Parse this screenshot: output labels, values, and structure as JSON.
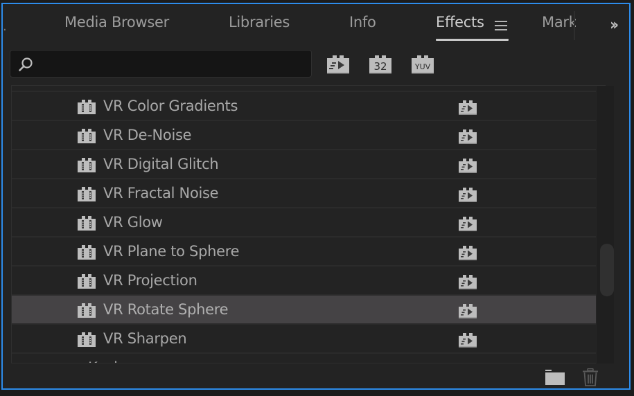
{
  "tabs": [
    {
      "label": "Media Browser",
      "active": false
    },
    {
      "label": "Libraries",
      "active": false
    },
    {
      "label": "Info",
      "active": false
    },
    {
      "label": "Effects",
      "active": true
    },
    {
      "label": "Markers",
      "visible_text": "Mark",
      "active": false
    }
  ],
  "tab_menu_icon": "hamburger-menu-icon",
  "overflow_icon": "double-chevron-right-icon",
  "search": {
    "value": "",
    "placeholder": "",
    "icon": "search-icon"
  },
  "filters": [
    {
      "name": "accelerated-effects-filter",
      "icon": "accelerated-effect-icon",
      "label": ""
    },
    {
      "name": "32-bit-filter",
      "icon": "32-bit-icon",
      "label": "32"
    },
    {
      "name": "yuv-filter",
      "icon": "yuv-icon",
      "label": "YUV"
    }
  ],
  "effects": [
    {
      "label": "VR Color Gradients",
      "accelerated": true,
      "selected": false
    },
    {
      "label": "VR De-Noise",
      "accelerated": true,
      "selected": false
    },
    {
      "label": "VR Digital Glitch",
      "accelerated": true,
      "selected": false
    },
    {
      "label": "VR Fractal Noise",
      "accelerated": true,
      "selected": false
    },
    {
      "label": "VR Glow",
      "accelerated": true,
      "selected": false
    },
    {
      "label": "VR Plane to Sphere",
      "accelerated": true,
      "selected": false
    },
    {
      "label": "VR Projection",
      "accelerated": true,
      "selected": false
    },
    {
      "label": "VR Rotate Sphere",
      "accelerated": true,
      "selected": true
    },
    {
      "label": "VR Sharpen",
      "accelerated": true,
      "selected": false
    }
  ],
  "folder_partial": {
    "label": "Keying",
    "expanded": false
  },
  "scroll": {
    "position_fraction": 0.62
  },
  "bottom": {
    "new_bin_icon": "new-bin-icon",
    "delete_icon": "trash-icon"
  },
  "colors": {
    "accent_border": "#2d8ceb",
    "selected_row": "#454345",
    "panel_bg": "#232323"
  }
}
